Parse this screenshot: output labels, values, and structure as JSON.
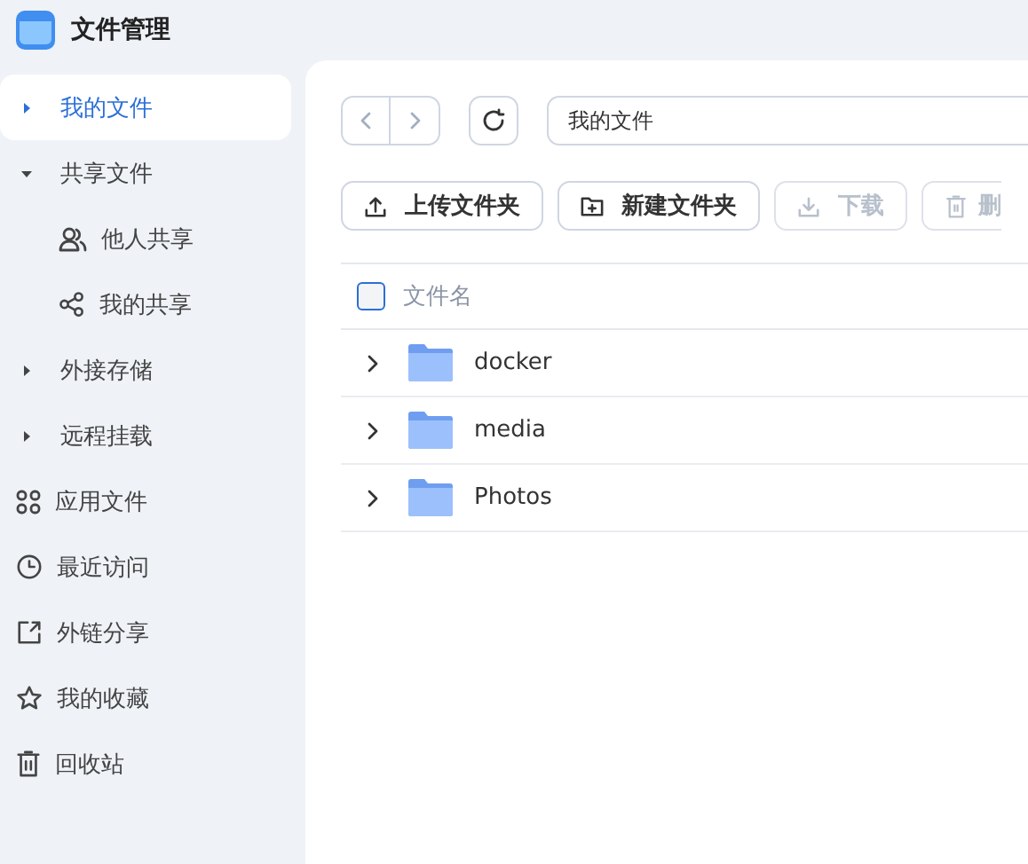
{
  "app": {
    "title": "文件管理"
  },
  "sidebar": {
    "tree": [
      {
        "label": "我的文件",
        "selected": true,
        "expanded": false
      },
      {
        "label": "共享文件",
        "selected": false,
        "expanded": true,
        "children": [
          {
            "label": "他人共享",
            "selected": false
          },
          {
            "label": "我的共享",
            "selected": false
          }
        ]
      },
      {
        "label": "外接存储",
        "selected": false,
        "expanded": false
      },
      {
        "label": "远程挂载",
        "selected": false,
        "expanded": false
      }
    ],
    "shortcuts": [
      {
        "label": "应用文件",
        "selected": false
      },
      {
        "label": "最近访问",
        "selected": false
      },
      {
        "label": "外链分享",
        "selected": false
      },
      {
        "label": "我的收藏",
        "selected": false
      },
      {
        "label": "回收站",
        "selected": false
      }
    ]
  },
  "path": {
    "value": "我的文件"
  },
  "actions": [
    {
      "label": "上传文件夹",
      "disabled": false
    },
    {
      "label": "新建文件夹",
      "disabled": false
    },
    {
      "label": "下载",
      "disabled": true
    },
    {
      "label": "删",
      "disabled": true
    }
  ],
  "table": {
    "columns": [
      "文件名"
    ],
    "all_checked": false,
    "rows": [
      {
        "name": "docker"
      },
      {
        "name": "media"
      },
      {
        "name": "Photos"
      }
    ]
  }
}
